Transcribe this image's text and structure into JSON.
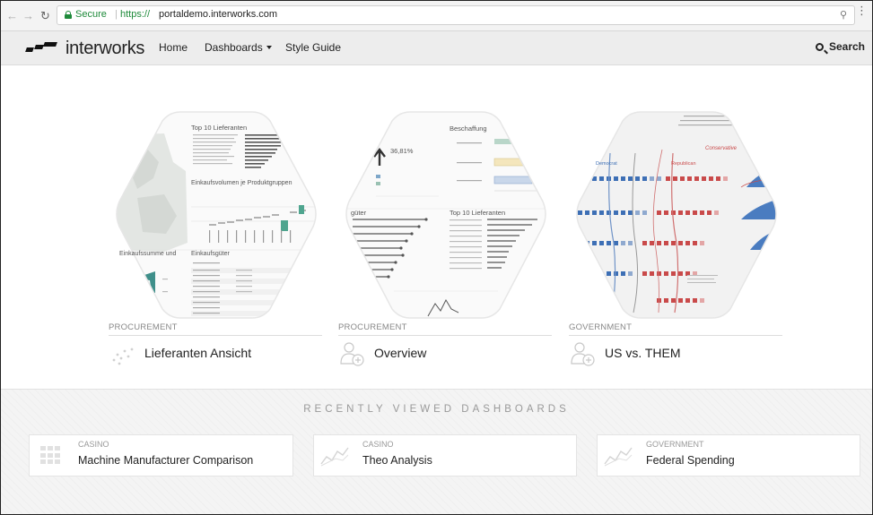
{
  "browser": {
    "secure_label": "Secure",
    "separator": "|",
    "url_protocol": "https://",
    "url_host": "portaldemo.interworks.com"
  },
  "navbar": {
    "logo_text": "interworks",
    "links": [
      {
        "label": "Home"
      },
      {
        "label": "Dashboards"
      },
      {
        "label": "Style Guide"
      }
    ],
    "search_label": "Search"
  },
  "featured": [
    {
      "category": "PROCUREMENT",
      "title": "Lieferanten Ansicht",
      "thumb_texts": [
        "Top 10 Lieferanten",
        "Einkaufsvolumen je Produktgruppen",
        "Einkaufssumme und",
        "Einkaufsgüter"
      ]
    },
    {
      "category": "PROCUREMENT",
      "title": "Overview",
      "thumb_texts": [
        "36,81%",
        "Beschaffung",
        "Top 10 Lieferanten",
        "güter"
      ]
    },
    {
      "category": "GOVERNMENT",
      "title": "US vs. THEM",
      "thumb_texts": [
        "Conservative",
        "Republican",
        "Democrat"
      ]
    }
  ],
  "recent": {
    "heading": "RECENTLY VIEWED DASHBOARDS",
    "items": [
      {
        "category": "CASINO",
        "title": "Machine Manufacturer Comparison"
      },
      {
        "category": "CASINO",
        "title": "Theo Analysis"
      },
      {
        "category": "GOVERNMENT",
        "title": "Federal Spending"
      }
    ]
  },
  "colors": {
    "secure_green": "#1e8a3a",
    "teal": "#4fa58f",
    "blue_accent": "#3d6fb5",
    "red_accent": "#c94a4a"
  }
}
